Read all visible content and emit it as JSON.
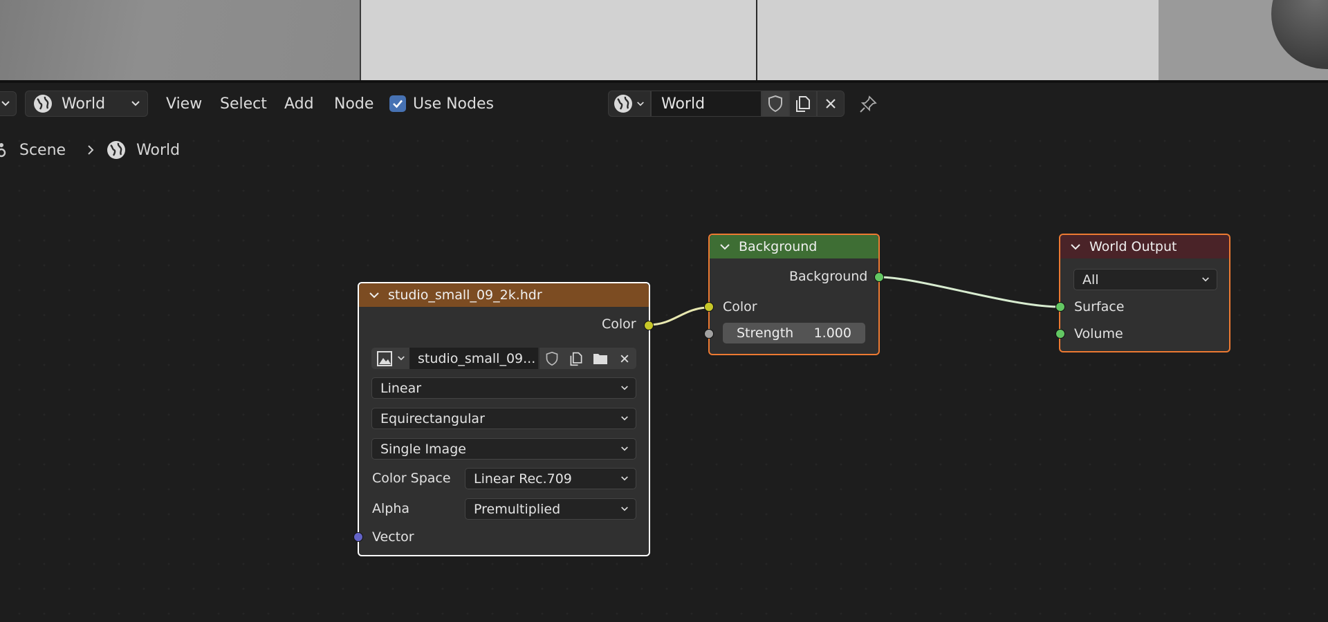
{
  "header": {
    "editor_type_chevron": "chevron-down-icon",
    "shader_type": "World",
    "menus": [
      "View",
      "Select",
      "Add",
      "Node"
    ],
    "use_nodes_label": "Use Nodes",
    "use_nodes_checked": true,
    "world_datablock": "World"
  },
  "breadcrumb": {
    "scene": "Scene",
    "world": "World"
  },
  "nodes": {
    "image": {
      "title": "studio_small_09_2k.hdr",
      "header_color": "#7c4c22",
      "output_color": "Color",
      "image_name": "studio_small_09...",
      "interpolation": "Linear",
      "projection": "Equirectangular",
      "source": "Single Image",
      "color_space_label": "Color Space",
      "color_space": "Linear Rec.709",
      "alpha_label": "Alpha",
      "alpha": "Premultiplied",
      "input_vector": "Vector"
    },
    "background": {
      "title": "Background",
      "header_color": "#3e6e34",
      "output": "Background",
      "input_color": "Color",
      "strength_label": "Strength",
      "strength_value": "1.000"
    },
    "world_output": {
      "title": "World Output",
      "header_color": "#4a2328",
      "target": "All",
      "input_surface": "Surface",
      "input_volume": "Volume"
    }
  },
  "colors": {
    "socket_color": "#c7c729",
    "socket_shader": "#63c763",
    "socket_float": "#a1a1a1",
    "socket_vector": "#6363c7",
    "selection_outline": "#ffffff",
    "active_outline": "#ed7a32"
  }
}
